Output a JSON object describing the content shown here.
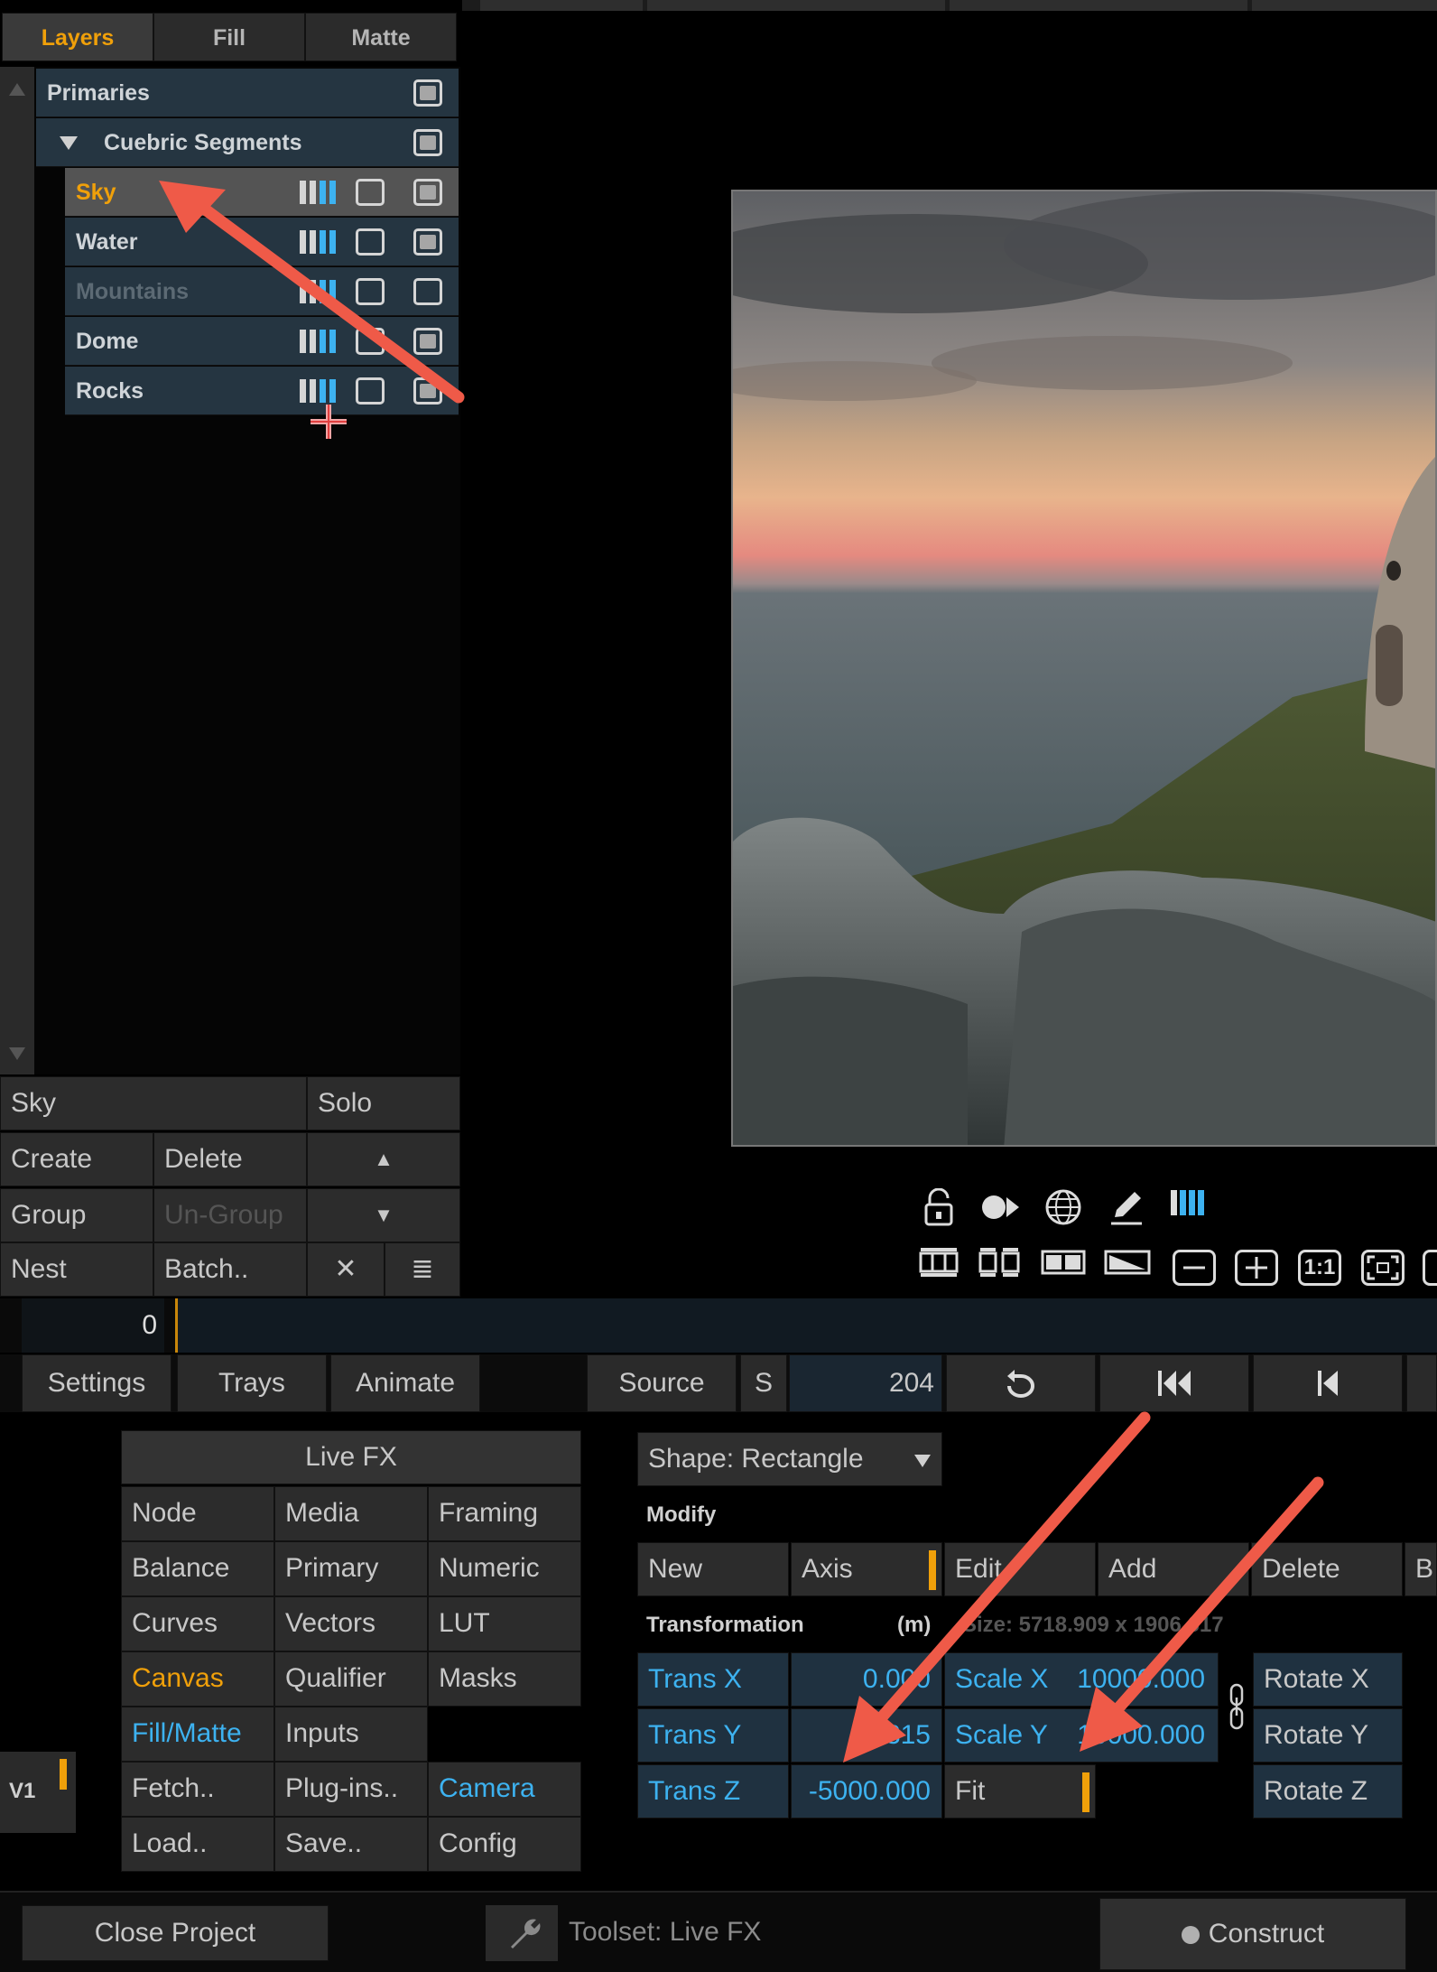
{
  "tabs": [
    "Layers",
    "Fill",
    "Matte"
  ],
  "layers": {
    "primaries": "Primaries",
    "group": "Cuebric Segments",
    "items": [
      {
        "name": "Sky",
        "selected": true,
        "dim": false
      },
      {
        "name": "Water",
        "selected": false,
        "dim": false
      },
      {
        "name": "Mountains",
        "selected": false,
        "dim": true
      },
      {
        "name": "Dome",
        "selected": false,
        "dim": false
      },
      {
        "name": "Rocks",
        "selected": false,
        "dim": false
      }
    ]
  },
  "layer_panel": {
    "current_layer": "Sky",
    "solo": "Solo",
    "create": "Create",
    "delete": "Delete",
    "group": "Group",
    "ungroup": "Un-Group",
    "nest": "Nest",
    "batch": "Batch..",
    "up_glyph": "▲",
    "down_glyph": "▼",
    "close_glyph": "✕",
    "menu_glyph": "≣"
  },
  "timeline": {
    "frame": "0"
  },
  "menubar": {
    "settings": "Settings",
    "trays": "Trays",
    "animate": "Animate",
    "source": "Source",
    "s": "S",
    "frame_count": "204"
  },
  "menu_grid": {
    "header": "Live FX",
    "items": [
      [
        "Node",
        "Media",
        "Framing"
      ],
      [
        "Balance",
        "Primary",
        "Numeric"
      ],
      [
        "Curves",
        "Vectors",
        "LUT"
      ],
      [
        "Canvas",
        "Qualifier",
        "Masks"
      ],
      [
        "Fill/Matte",
        "Inputs",
        ""
      ],
      [
        "Fetch..",
        "Plug-ins..",
        "Camera"
      ],
      [
        "Load..",
        "Save..",
        "Config"
      ]
    ]
  },
  "track_label": "V1",
  "shape": {
    "dropdown": "Shape: Rectangle",
    "modify": "Modify",
    "new": "New",
    "axis": "Axis",
    "edit": "Edit",
    "add": "Add",
    "delete": "Delete",
    "b": "B",
    "transformation": "Transformation",
    "units": "(m)",
    "size": "Size: 5718.909 x 1906.617",
    "trans_x_label": "Trans X",
    "trans_x": "0.000",
    "trans_y_label": "Trans Y",
    "trans_y": "315",
    "trans_z_label": "Trans Z",
    "trans_z": "-5000.000",
    "scale_x_label": "Scale X",
    "scale_x": "10000.000",
    "scale_y_label": "Scale Y",
    "scale_y": "10000.000",
    "fit": "Fit",
    "rotate_x": "Rotate X",
    "rotate_y": "Rotate Y",
    "rotate_z": "Rotate Z"
  },
  "footer": {
    "close_project": "Close Project",
    "toolset": "Toolset: Live FX",
    "construct": "Construct"
  },
  "colors": {
    "accent": "#f0a00a",
    "blue": "#3db2f0",
    "arrow": "#ef5a48"
  }
}
